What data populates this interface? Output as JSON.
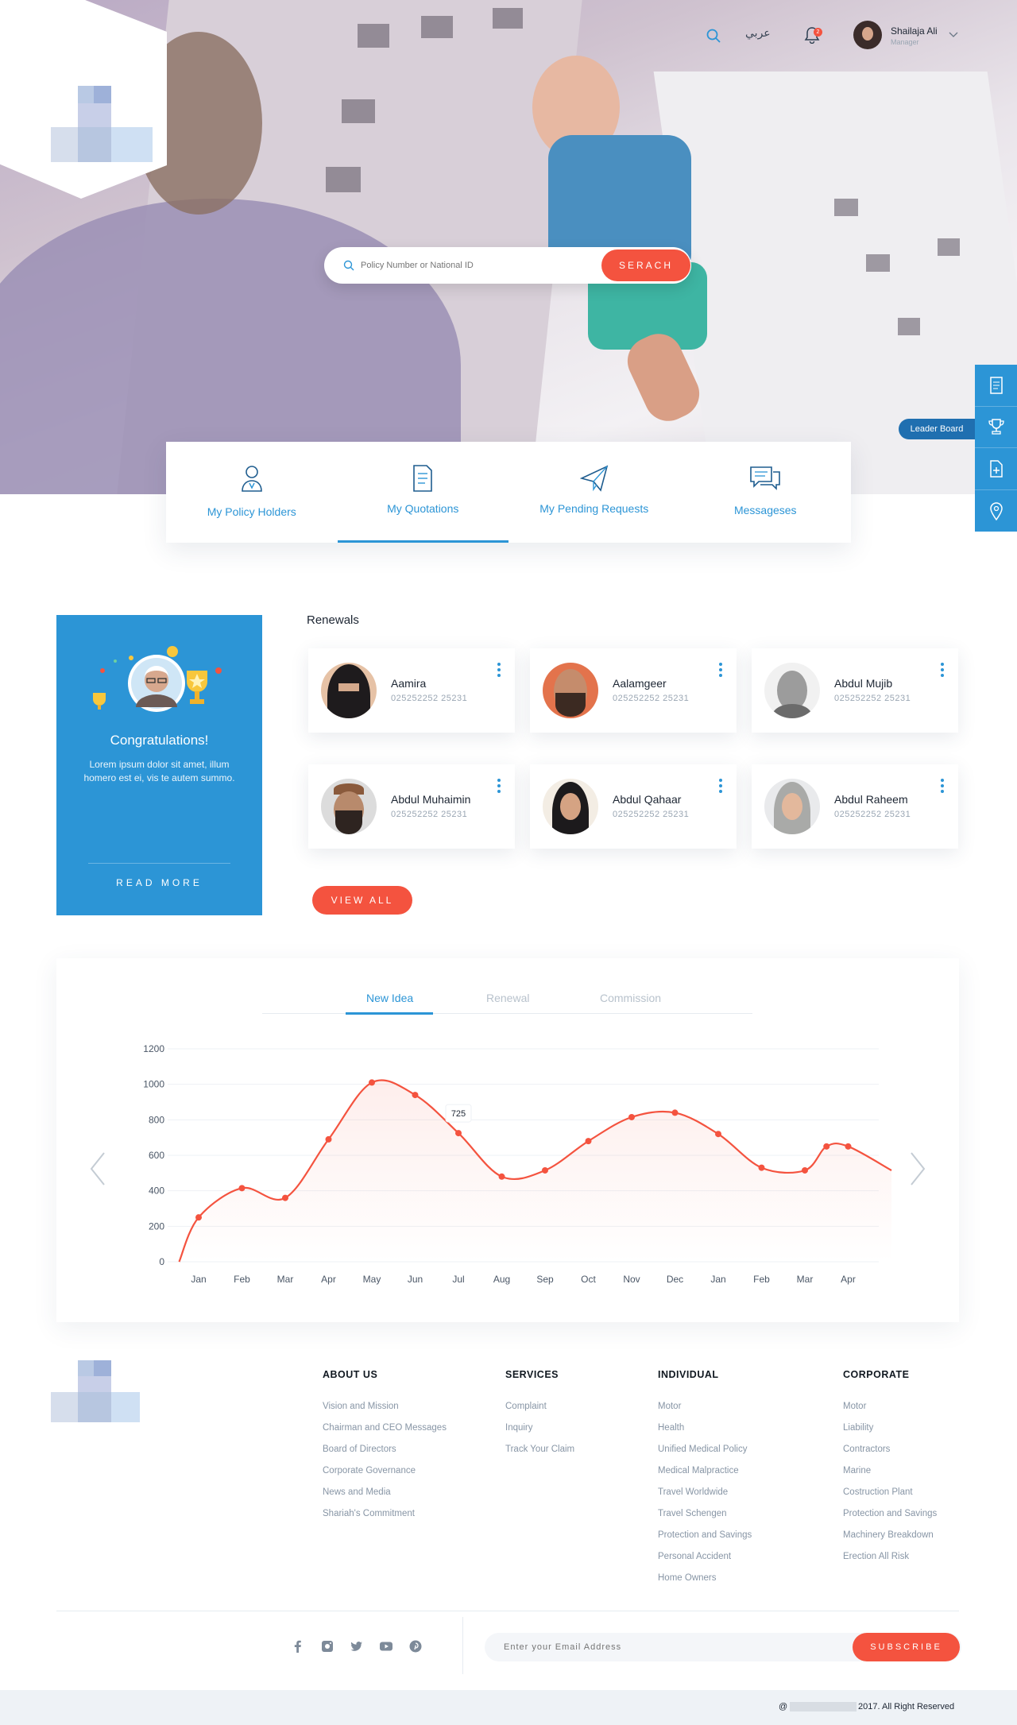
{
  "header": {
    "language_label": "عربي",
    "notification_count": "2",
    "user_name": "Shailaja Ali",
    "user_role": "Manager"
  },
  "search": {
    "placeholder": "Policy Number or National ID",
    "button_label": "SERACH"
  },
  "tabs": [
    {
      "label": "My Policy Holders",
      "icon": "user-icon"
    },
    {
      "label": "My Quotations",
      "icon": "document-icon",
      "active": true
    },
    {
      "label": "My Pending Requests",
      "icon": "paper-plane-icon"
    },
    {
      "label": "Messageses",
      "icon": "chat-icon"
    }
  ],
  "dock": {
    "tooltip": "Leader Board",
    "items": [
      "document-icon",
      "trophy-icon",
      "add-file-icon",
      "location-pin-icon"
    ]
  },
  "congrats": {
    "title": "Congratulations!",
    "body": "Lorem ipsum dolor sit amet, illum homero est ei, vis te autem summo.",
    "link": "READ MORE"
  },
  "renewals": {
    "title": "Renewals",
    "items": [
      {
        "name": "Aamira",
        "phone": "025252252 25231"
      },
      {
        "name": "Aalamgeer",
        "phone": "025252252 25231"
      },
      {
        "name": "Abdul Mujib",
        "phone": "025252252 25231"
      },
      {
        "name": "Abdul Muhaimin",
        "phone": "025252252 25231"
      },
      {
        "name": "Abdul Qahaar",
        "phone": "025252252 25231"
      },
      {
        "name": "Abdul Raheem",
        "phone": "025252252 25231"
      }
    ],
    "view_all": "VIEW ALL"
  },
  "chart_tabs": [
    "New Idea",
    "Renewal",
    "Commission"
  ],
  "chart_data": {
    "type": "line",
    "categories": [
      "Jan",
      "Feb",
      "Mar",
      "Apr",
      "May",
      "Jun",
      "Jul",
      "Aug",
      "Sep",
      "Oct",
      "Nov",
      "Dec",
      "Jan",
      "Feb",
      "Mar",
      "Apr"
    ],
    "y_ticks": [
      "0",
      "200",
      "400",
      "600",
      "800",
      "1000",
      "1200"
    ],
    "ylim": [
      0,
      1200
    ],
    "grid": true,
    "series": [
      {
        "color": "#f4533f",
        "points": [
          [
            -0.45,
            0
          ],
          [
            0,
            250
          ],
          [
            1,
            415
          ],
          [
            2,
            360
          ],
          [
            3,
            690
          ],
          [
            4,
            1010
          ],
          [
            5,
            940
          ],
          [
            6,
            725
          ],
          [
            7,
            480
          ],
          [
            8,
            515
          ],
          [
            9,
            680
          ],
          [
            10,
            815
          ],
          [
            11,
            840
          ],
          [
            12,
            720
          ],
          [
            13,
            530
          ],
          [
            14,
            515
          ],
          [
            14.5,
            650
          ],
          [
            15,
            650
          ],
          [
            16,
            515
          ]
        ]
      }
    ],
    "tooltip": {
      "label": "725",
      "category": "Jul"
    }
  },
  "footer": {
    "columns": [
      {
        "title": "ABOUT US",
        "links": [
          "Vision and Mission",
          "Chairman and CEO Messages",
          "Board of Directors",
          "Corporate Governance",
          "News and Media",
          "Shariah's Commitment"
        ]
      },
      {
        "title": "SERVICES",
        "links": [
          "Complaint",
          "Inquiry",
          "Track Your Claim"
        ]
      },
      {
        "title": "INDIVIDUAL",
        "links": [
          "Motor",
          "Health",
          "Unified Medical Policy",
          "Medical Malpractice",
          "Travel Worldwide",
          "Travel Schengen",
          "Protection and Savings",
          "Personal Accident",
          "Home Owners"
        ]
      },
      {
        "title": "CORPORATE",
        "links": [
          "Motor",
          "Liability",
          "Contractors",
          "Marine",
          "Costruction Plant",
          "Protection and Savings",
          "Machinery Breakdown",
          "Erection All Risk"
        ]
      }
    ],
    "social": [
      "facebook-icon",
      "instagram-icon",
      "twitter-icon",
      "youtube-icon",
      "pinterest-icon"
    ],
    "email_placeholder": "Enter your Email Address",
    "subscribe_label": "SUBSCRIBE",
    "copyright": "2017. All Right Reserved",
    "copyright_prefix": "@"
  },
  "colors": {
    "accent": "#2c95d6",
    "cta": "#f4533f",
    "text_dark": "#1d2633",
    "muted": "#8795a5"
  }
}
